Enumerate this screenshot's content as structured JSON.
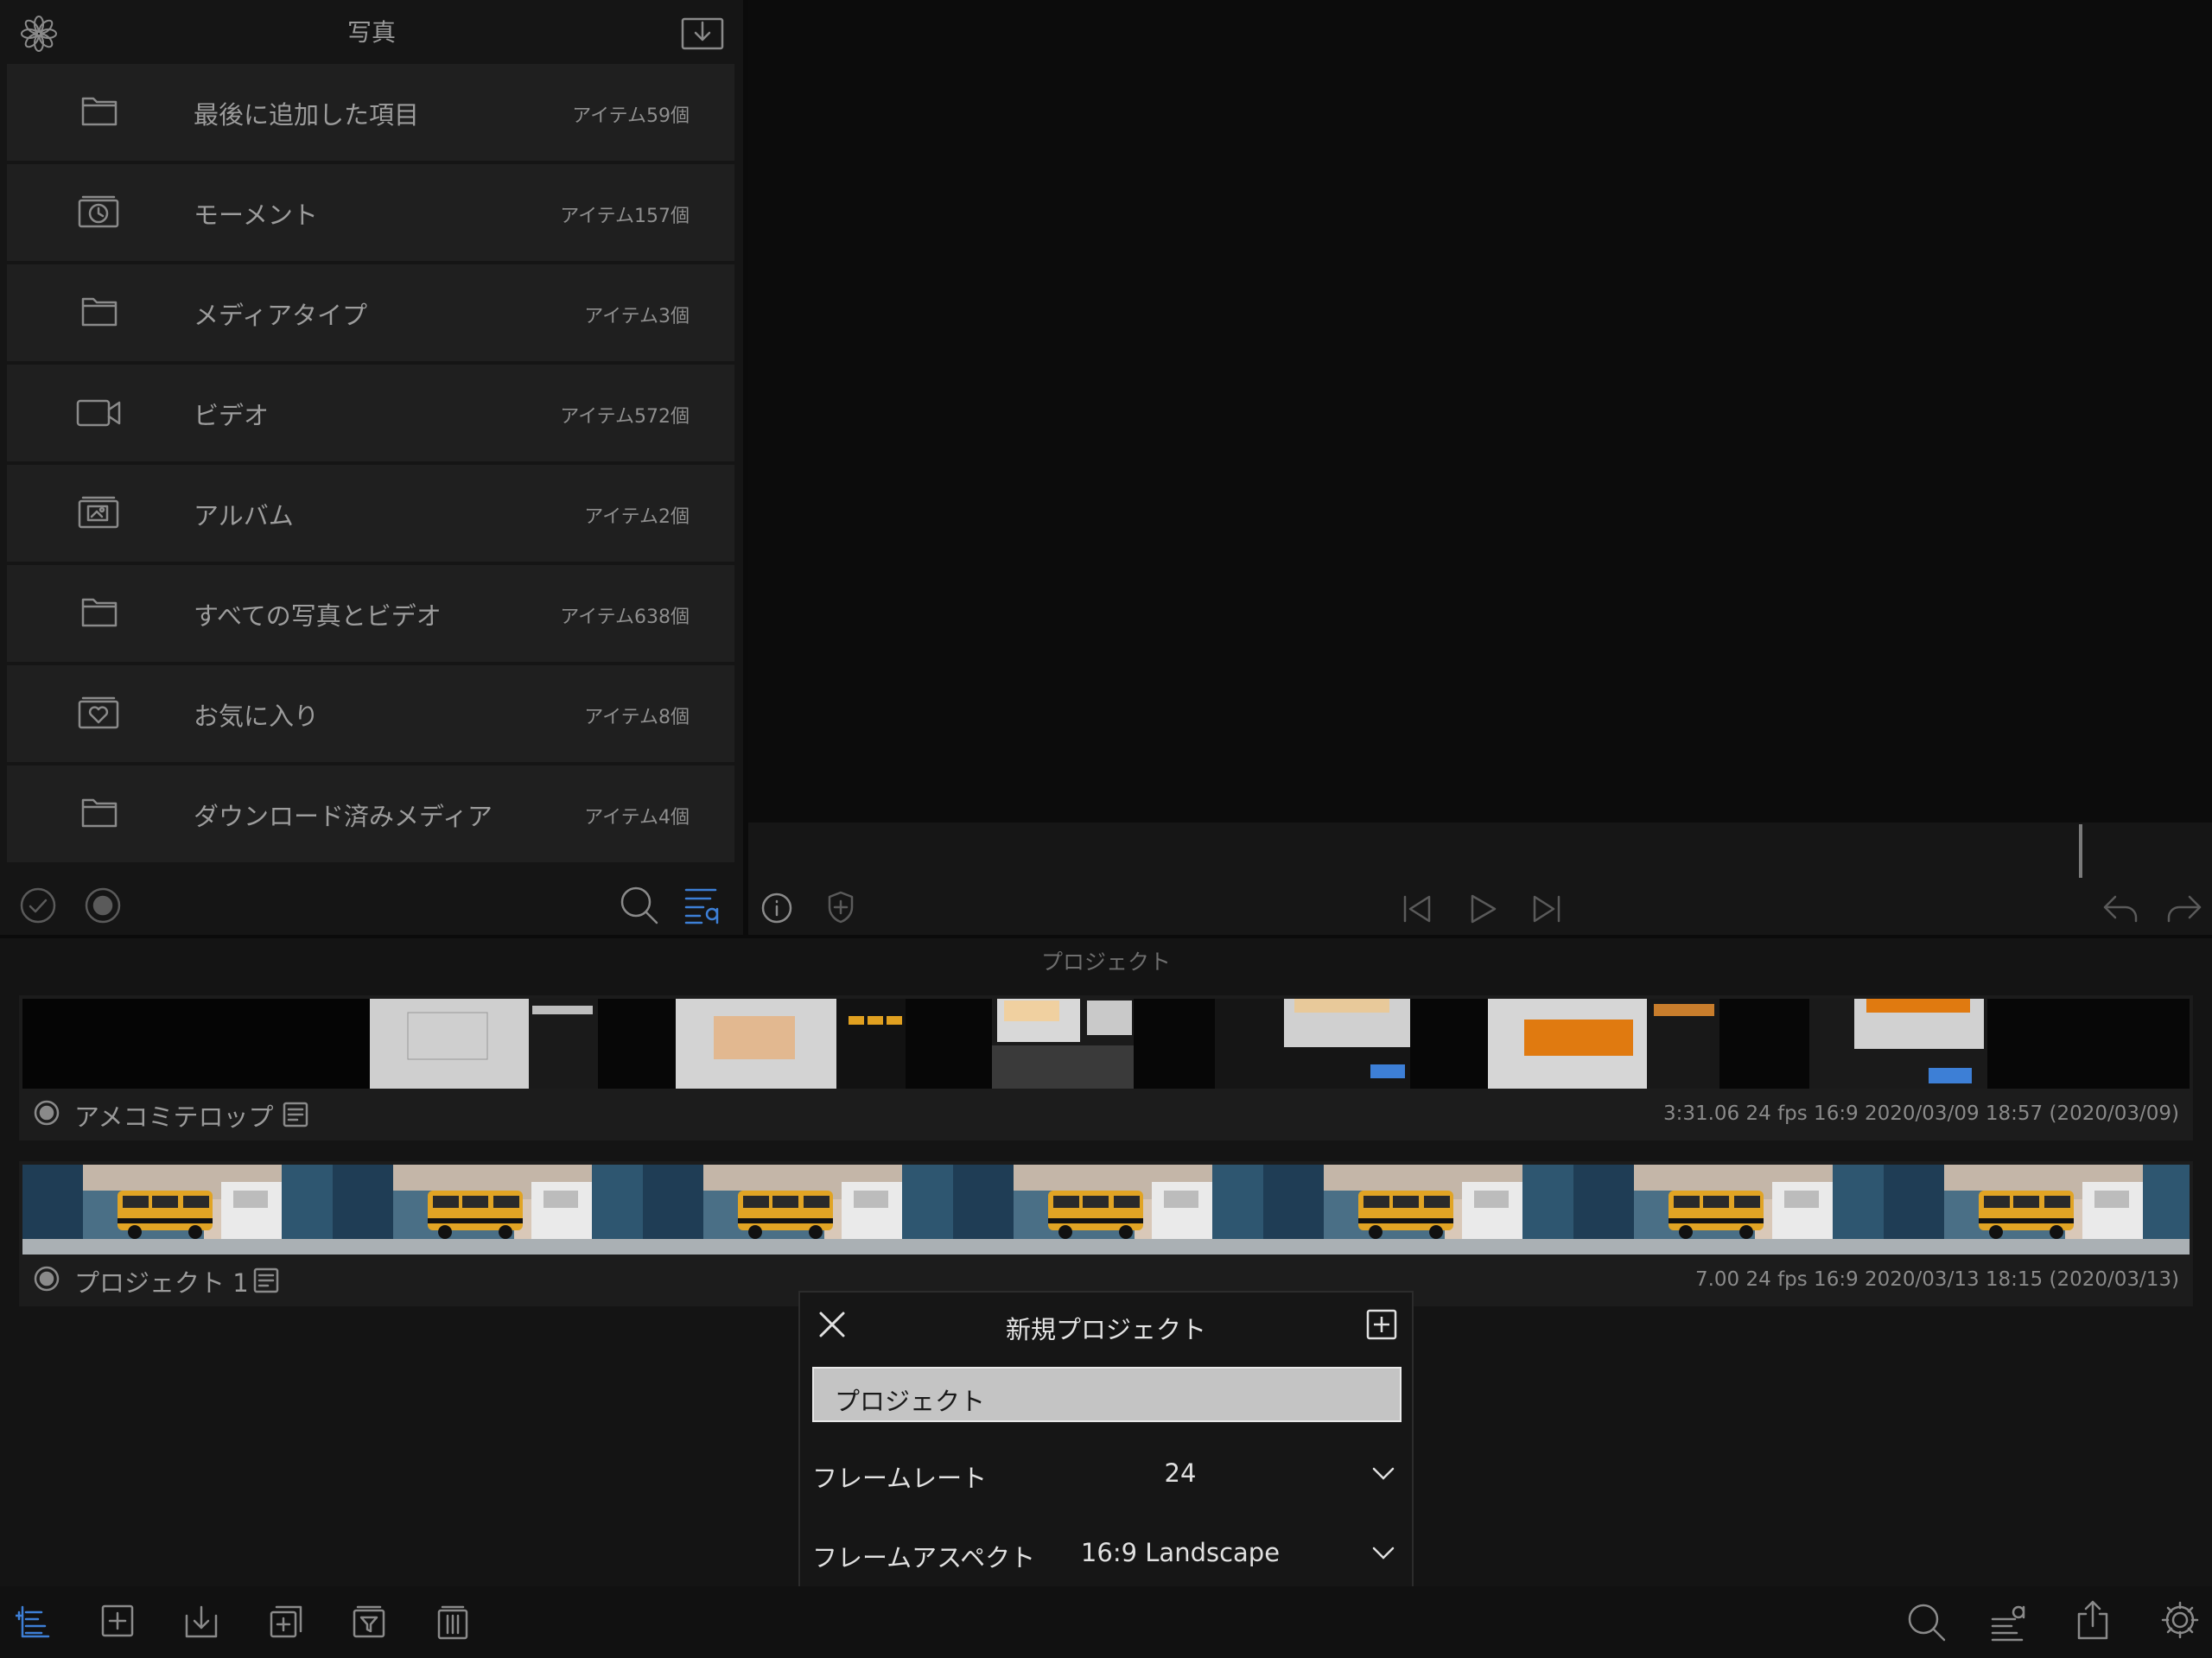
{
  "media_panel": {
    "title": "写真",
    "rows": [
      {
        "label": "最後に追加した項目",
        "count": "アイテム59個",
        "icon": "folder-icon"
      },
      {
        "label": "モーメント",
        "count": "アイテム157個",
        "icon": "moments-icon"
      },
      {
        "label": "メディアタイプ",
        "count": "アイテム3個",
        "icon": "folder-icon"
      },
      {
        "label": "ビデオ",
        "count": "アイテム572個",
        "icon": "video-camera-icon"
      },
      {
        "label": "アルバム",
        "count": "アイテム2個",
        "icon": "album-icon"
      },
      {
        "label": "すべての写真とビデオ",
        "count": "アイテム638個",
        "icon": "folder-icon"
      },
      {
        "label": "お気に入り",
        "count": "アイテム8個",
        "icon": "favorites-icon"
      },
      {
        "label": "ダウンロード済みメディア",
        "count": "アイテム4個",
        "icon": "folder-icon"
      }
    ]
  },
  "projects": {
    "header": "プロジェクト",
    "items": [
      {
        "name": "アメコミテロップ",
        "meta": "3:31.06   24 fps   16:9   2020/03/09 18:57   (2020/03/09)"
      },
      {
        "name": "プロジェクト 1",
        "meta": "7.00   24 fps   16:9   2020/03/13 18:15   (2020/03/13)"
      }
    ]
  },
  "dialog": {
    "title": "新規プロジェクト",
    "name_value": "プロジェクト",
    "frame_rate_label": "フレームレート",
    "frame_rate_value": "24",
    "aspect_label": "フレームアスペクト",
    "aspect_value": "16:9  Landscape"
  },
  "colors": {
    "accent": "#3d7fd6",
    "background": "#0b0b0b",
    "panel": "#1f1f1f"
  }
}
